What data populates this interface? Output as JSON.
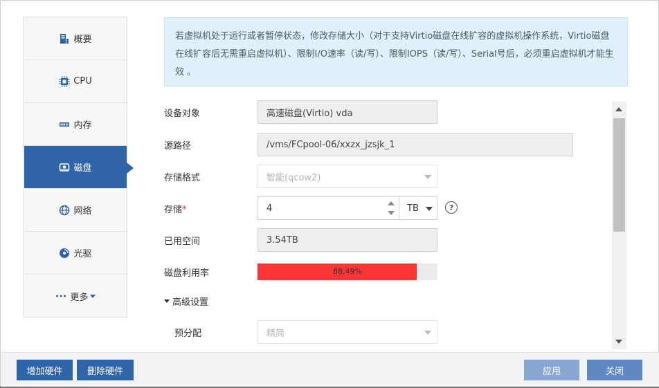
{
  "sidebar": {
    "items": [
      {
        "label": "概要",
        "icon": "server-icon"
      },
      {
        "label": "CPU",
        "icon": "cpu-icon"
      },
      {
        "label": "内存",
        "icon": "memory-icon"
      },
      {
        "label": "磁盘",
        "icon": "disk-icon",
        "active": true
      },
      {
        "label": "网络",
        "icon": "globe-icon"
      },
      {
        "label": "光驱",
        "icon": "cdrom-icon"
      },
      {
        "label": "更多",
        "icon": "more-dots-icon"
      }
    ]
  },
  "notice": {
    "text": "若虚拟机处于运行或者暂停状态，修改存储大小（对于支持Virtio磁盘在线扩容的虚拟机操作系统，Virtio磁盘在线扩容后无需重启虚拟机）、限制I/O速率（读/写）、限制IOPS（读/写）、Serial号后，必须重启虚拟机才能生效 。"
  },
  "form": {
    "device_label": "设备对象",
    "device_value": "高速磁盘(Virtio) vda",
    "path_label": "源路径",
    "path_value": "/vms/FCpool-06/xxzx_jzsjk_1",
    "format_label": "存储格式",
    "format_value": "智能(qcow2)",
    "storage_label": "存储",
    "storage_required": "*",
    "storage_value": "4",
    "storage_unit": "TB",
    "help_symbol": "?",
    "used_label": "已用空间",
    "used_value": "3.54TB",
    "usage_label": "磁盘利用率",
    "usage_text": "88.49%",
    "usage_fraction": 0.8849,
    "advanced_label": "高级设置",
    "prealloc_label": "预分配",
    "prealloc_value": "精简"
  },
  "footer": {
    "add_hw": "增加硬件",
    "remove_hw": "删除硬件",
    "apply": "应用",
    "close": "关闭"
  },
  "colors": {
    "accent": "#2f64a8",
    "usage_bar": "#fb3636",
    "notice_bg": "#dff1fb"
  }
}
